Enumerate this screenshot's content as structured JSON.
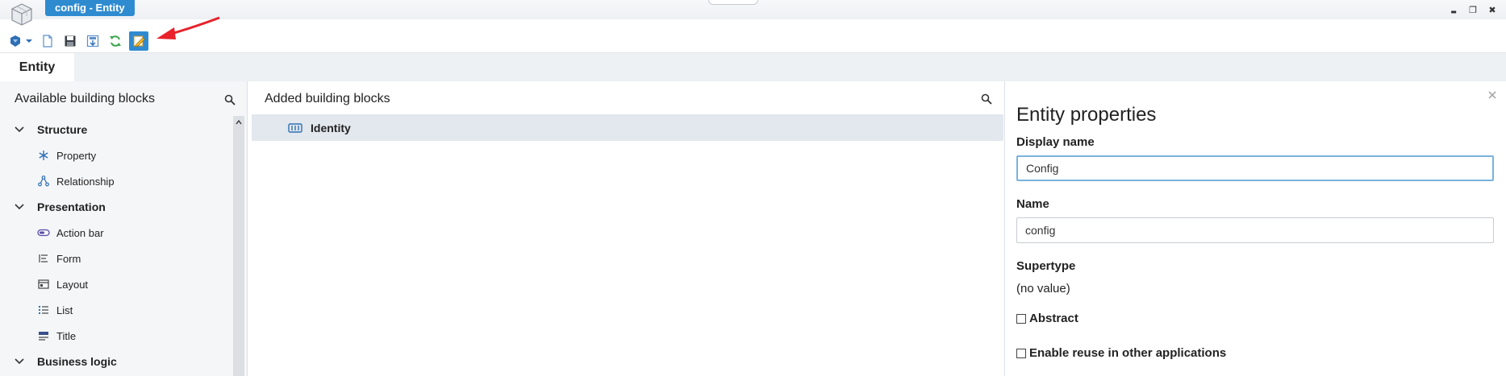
{
  "window": {
    "title": "config - Entity",
    "controls": {
      "minimize": "▬",
      "restore": "❐",
      "close": "✖"
    }
  },
  "toolbar": {
    "buttons": [
      "app-menu-icon",
      "new-document-icon",
      "save-icon",
      "save-all-icon",
      "refresh-icon",
      "edit-icon"
    ]
  },
  "module_tab": {
    "label": "Entity"
  },
  "left": {
    "title": "Available building blocks",
    "groups": [
      {
        "label": "Structure",
        "items": [
          "Property",
          "Relationship"
        ]
      },
      {
        "label": "Presentation",
        "items": [
          "Action bar",
          "Form",
          "Layout",
          "List",
          "Title"
        ]
      },
      {
        "label": "Business logic",
        "items": []
      }
    ]
  },
  "middle": {
    "title": "Added building blocks",
    "rows": [
      "Identity"
    ]
  },
  "right": {
    "title": "Entity properties",
    "display_name_label": "Display name",
    "display_name_value": "Config",
    "name_label": "Name",
    "name_value": "config",
    "supertype_label": "Supertype",
    "supertype_value": "(no value)",
    "abstract_label": "Abstract",
    "reuse_label": "Enable reuse in other applications"
  },
  "colors": {
    "accent": "#2f8bd0",
    "selected_row": "#e2e8ed",
    "annotation_arrow": "#e8212a"
  }
}
